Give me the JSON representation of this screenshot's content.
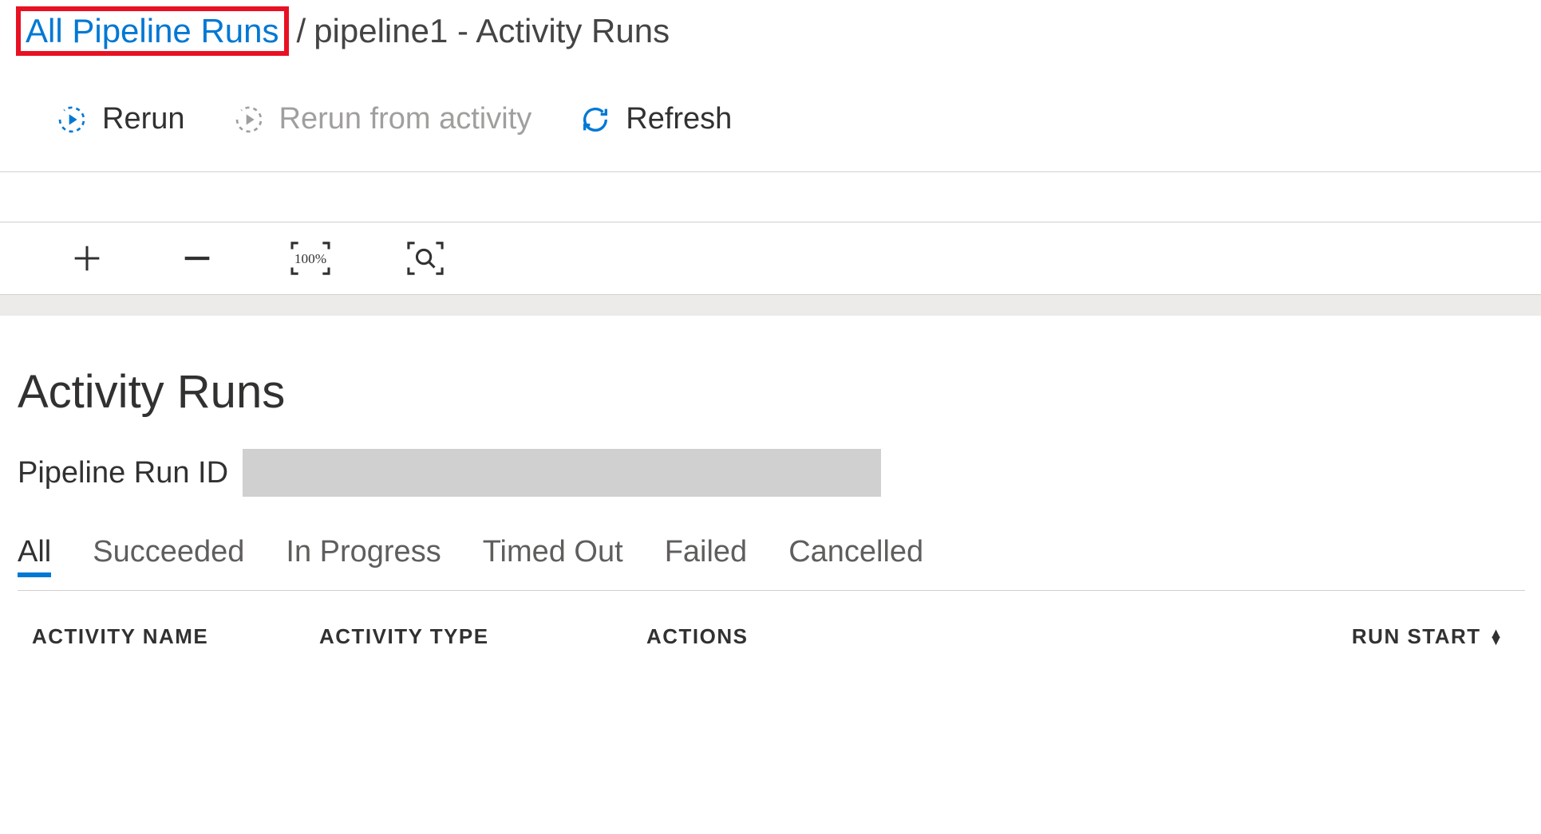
{
  "breadcrumb": {
    "link_label": "All Pipeline Runs",
    "separator": "/",
    "current": "pipeline1 - Activity Runs"
  },
  "toolbar": {
    "rerun_label": "Rerun",
    "rerun_from_activity_label": "Rerun from activity",
    "refresh_label": "Refresh"
  },
  "canvas": {
    "zoom_fit_label": "100%"
  },
  "section": {
    "title": "Activity Runs",
    "run_id_label": "Pipeline Run ID",
    "run_id_value": ""
  },
  "filters": {
    "items": [
      {
        "label": "All",
        "active": true
      },
      {
        "label": "Succeeded",
        "active": false
      },
      {
        "label": "In Progress",
        "active": false
      },
      {
        "label": "Timed Out",
        "active": false
      },
      {
        "label": "Failed",
        "active": false
      },
      {
        "label": "Cancelled",
        "active": false
      }
    ]
  },
  "table": {
    "columns": {
      "activity_name": "ACTIVITY NAME",
      "activity_type": "ACTIVITY TYPE",
      "actions": "ACTIONS",
      "run_start": "RUN START"
    }
  },
  "colors": {
    "accent": "#0078d4",
    "highlight_border": "#e81123"
  }
}
